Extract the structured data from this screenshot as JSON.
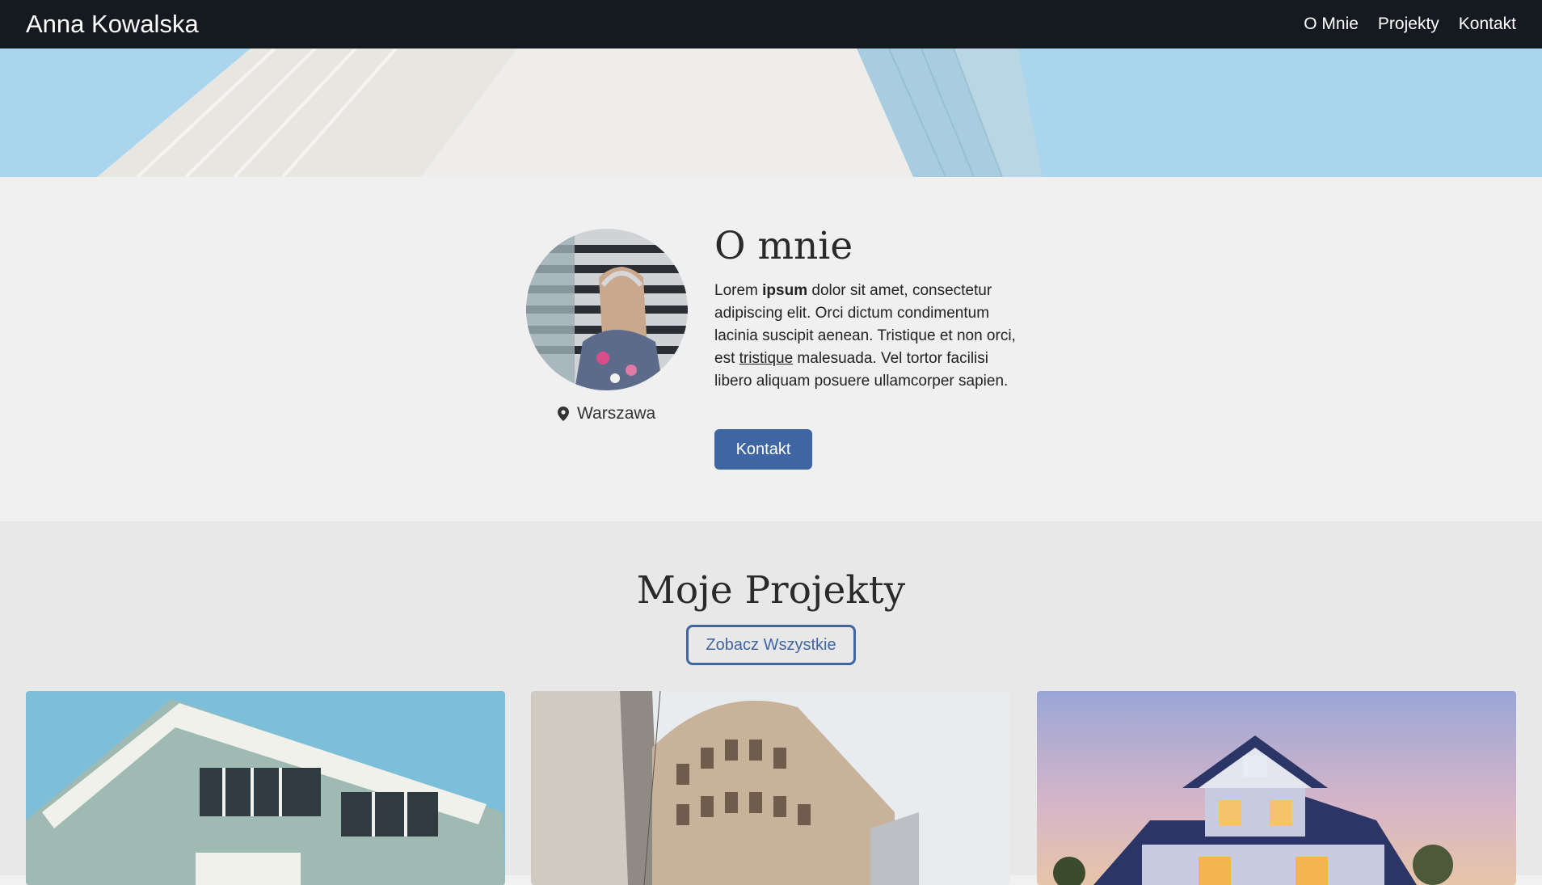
{
  "header": {
    "brand": "Anna Kowalska",
    "nav": [
      "O Mnie",
      "Projekty",
      "Kontakt"
    ]
  },
  "about": {
    "title": "O mnie",
    "location": "Warszawa",
    "location_icon": "map-pin-icon",
    "text_parts": {
      "p1": "Lorem ",
      "bold": "ipsum",
      "p2": " dolor sit amet, consectetur adipiscing elit. Orci dictum condimentum lacinia suscipit aenean. Tristique et non orci, est ",
      "underline": "tristique",
      "p3": " malesuada. Vel tortor facilisi libero aliquam posuere ullamcorper sapien."
    },
    "button_label": "Kontakt"
  },
  "projects": {
    "title": "Moje Projekty",
    "button_label": "Zobacz Wszystkie"
  },
  "colors": {
    "navbar": "#151a20",
    "accent": "#3f66a3",
    "about_bg": "#f0f0f0",
    "projects_bg": "#e8e8e8"
  }
}
